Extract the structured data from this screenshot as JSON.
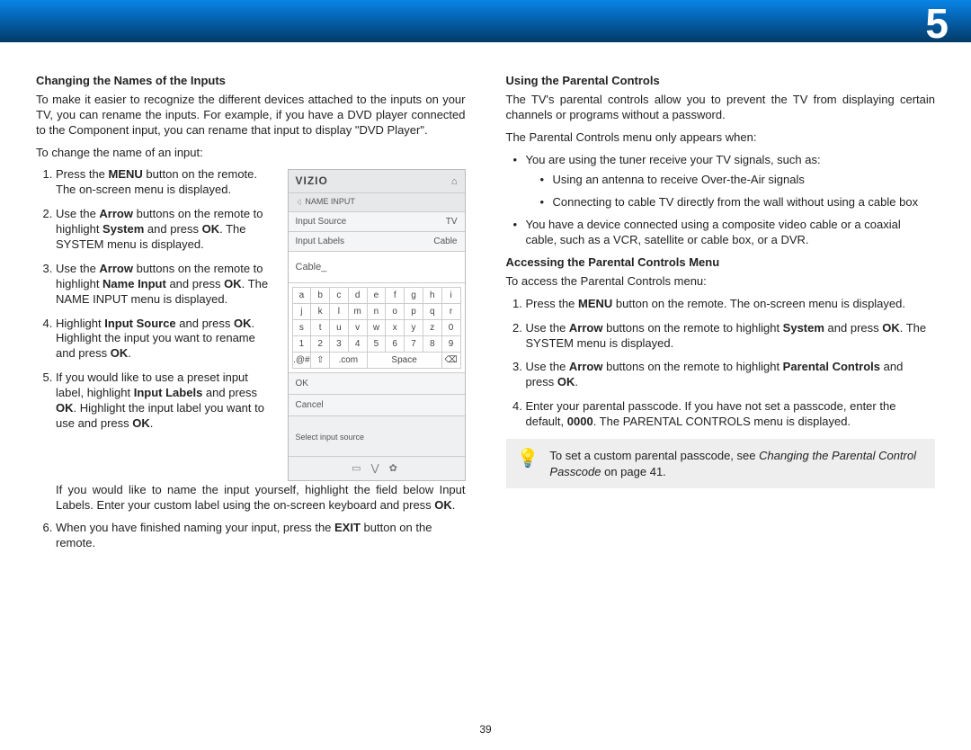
{
  "chapter_number": "5",
  "page_number": "39",
  "left": {
    "h1": "Changing the Names of the Inputs",
    "intro": "To make it easier to recognize the different devices attached to the inputs on your TV, you can rename the inputs. For example, if you have a DVD player connected to the Component input, you can rename that input to display \"DVD Player\".",
    "lead": "To change the name of an input:",
    "s1a": "Press the ",
    "s1b": "MENU",
    "s1c": " button on the remote. The on-screen menu is displayed.",
    "s2a": "Use the ",
    "s2b": "Arrow",
    "s2c": " buttons on the remote to highlight ",
    "s2d": "System",
    "s2e": " and press ",
    "s2f": "OK",
    "s2g": ". The SYSTEM menu is displayed.",
    "s3a": "Use the ",
    "s3b": "Arrow",
    "s3c": " buttons on the remote to highlight ",
    "s3d": "Name Input",
    "s3e": " and press ",
    "s3f": "OK",
    "s3g": ". The NAME INPUT menu is displayed.",
    "s4a": "Highlight ",
    "s4b": "Input Source",
    "s4c": " and press ",
    "s4d": "OK",
    "s4e": ". Highlight the input you want to rename and press ",
    "s4f": "OK",
    "s4g": ".",
    "s5a": "If you would like to use a preset input label, highlight ",
    "s5b": "Input Labels",
    "s5c": " and press ",
    "s5d": "OK",
    "s5e": ". Highlight the input label you want to use and press ",
    "s5f": "OK",
    "s5g": ".",
    "s5post1": "If you would like to name the input yourself, highlight the field below Input Labels. Enter your custom label using the on-screen keyboard and press ",
    "s5post1b": "OK",
    "s5post1c": ".",
    "s6a": "When you have finished naming your input, press the ",
    "s6b": "EXIT",
    "s6c": " button on the remote."
  },
  "menu": {
    "logo": "VIZIO",
    "breadcrumb": "NAME INPUT",
    "row1l": "Input Source",
    "row1r": "TV",
    "row2l": "Input Labels",
    "row2r": "Cable",
    "field": "Cable_",
    "keys": [
      [
        "a",
        "b",
        "c",
        "d",
        "e",
        "f",
        "g",
        "h",
        "i"
      ],
      [
        "j",
        "k",
        "l",
        "m",
        "n",
        "o",
        "p",
        "q",
        "r"
      ],
      [
        "s",
        "t",
        "u",
        "v",
        "w",
        "x",
        "y",
        "z",
        "0"
      ],
      [
        "1",
        "2",
        "3",
        "4",
        "5",
        "6",
        "7",
        "8",
        "9"
      ],
      [
        ".@#",
        "⇧",
        ".com",
        "Space",
        "⌫"
      ]
    ],
    "ok": "OK",
    "cancel": "Cancel",
    "hint": "Select input source",
    "footer_icons": "▭  ⋁  ✿"
  },
  "right": {
    "h1": "Using the Parental Controls",
    "p1": "The TV's parental controls allow you to prevent the TV from displaying certain channels or programs without a password.",
    "p2": "The Parental Controls menu only appears when:",
    "b1": "You are using the tuner receive your TV signals, such as:",
    "b1a": "Using an antenna to receive Over-the-Air signals",
    "b1b": "Connecting to cable TV directly from the wall without using a cable box",
    "b2": "You have a device connected using a composite video cable or a coaxial cable, such as a VCR, satellite or cable box, or a DVR.",
    "h2": "Accessing the Parental Controls Menu",
    "p3": "To access the Parental Controls menu:",
    "s1a": "Press the ",
    "s1b": "MENU",
    "s1c": " button on the remote. The on-screen menu is displayed.",
    "s2a": "Use the ",
    "s2b": "Arrow",
    "s2c": " buttons on the remote to highlight ",
    "s2d": "System",
    "s2e": " and press ",
    "s2f": "OK",
    "s2g": ". The SYSTEM menu is displayed.",
    "s3a": "Use the ",
    "s3b": "Arrow",
    "s3c": " buttons on the remote to highlight ",
    "s3d": "Parental Controls",
    "s3e": " and press ",
    "s3f": "OK",
    "s3g": ".",
    "s4a": "Enter your parental passcode. If you have not set a passcode, enter the default, ",
    "s4b": "0000",
    "s4c": ". The PARENTAL CONTROLS menu is displayed.",
    "tip1": "To set a custom parental passcode, see ",
    "tip2": "Changing the Parental Control Passcode",
    "tip3": " on page 41."
  }
}
